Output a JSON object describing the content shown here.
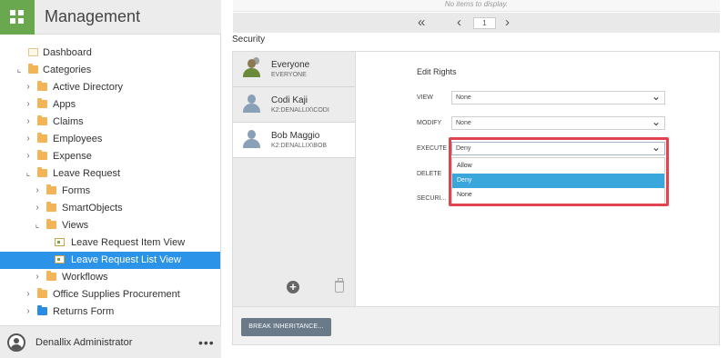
{
  "sidebar": {
    "title": "Management",
    "tree": [
      {
        "label": "Dashboard",
        "icon": "dashboard-icon"
      },
      {
        "label": "Categories",
        "icon": "folder-icon"
      },
      {
        "label": "Active Directory",
        "icon": "folder-icon"
      },
      {
        "label": "Apps",
        "icon": "folder-icon"
      },
      {
        "label": "Claims",
        "icon": "folder-icon"
      },
      {
        "label": "Employees",
        "icon": "folder-icon"
      },
      {
        "label": "Expense",
        "icon": "folder-icon"
      },
      {
        "label": "Leave Request",
        "icon": "folder-icon"
      },
      {
        "label": "Forms",
        "icon": "folder-icon"
      },
      {
        "label": "SmartObjects",
        "icon": "folder-icon"
      },
      {
        "label": "Views",
        "icon": "folder-icon"
      },
      {
        "label": "Leave Request Item View",
        "icon": "view-icon"
      },
      {
        "label": "Leave Request List View",
        "icon": "view-icon",
        "selected": true
      },
      {
        "label": "Workflows",
        "icon": "folder-icon"
      },
      {
        "label": "Office Supplies Procurement",
        "icon": "folder-icon"
      },
      {
        "label": "Returns Form",
        "icon": "folder-icon"
      }
    ],
    "footer": {
      "user": "Denallix Administrator",
      "more": "•••"
    }
  },
  "main": {
    "no_items": "No items to display.",
    "pager": {
      "first": "«",
      "prev": "‹",
      "page": "1",
      "next": "›"
    },
    "security_title": "Security",
    "users": [
      {
        "name": "Everyone",
        "id": "EVERYONE"
      },
      {
        "name": "Codi Kaji",
        "id": "K2:DENALLIX\\CODI"
      },
      {
        "name": "Bob Maggio",
        "id": "K2:DENALLIX\\BOB"
      }
    ],
    "rights": {
      "title": "Edit Rights",
      "view_label": "VIEW",
      "view_value": "None",
      "modify_label": "MODIFY",
      "modify_value": "None",
      "execute_label": "EXECUTE",
      "execute_value": "Deny",
      "delete_label": "DELETE",
      "security_label": "SECURI...",
      "options": [
        "Allow",
        "Deny",
        "None"
      ]
    },
    "break_button": "BREAK INHERITANCE..."
  },
  "colors": {
    "accent": "#2c94e8",
    "tile": "#6aa84f",
    "highlight": "#e0454f",
    "selected_option": "#39a6dc"
  }
}
